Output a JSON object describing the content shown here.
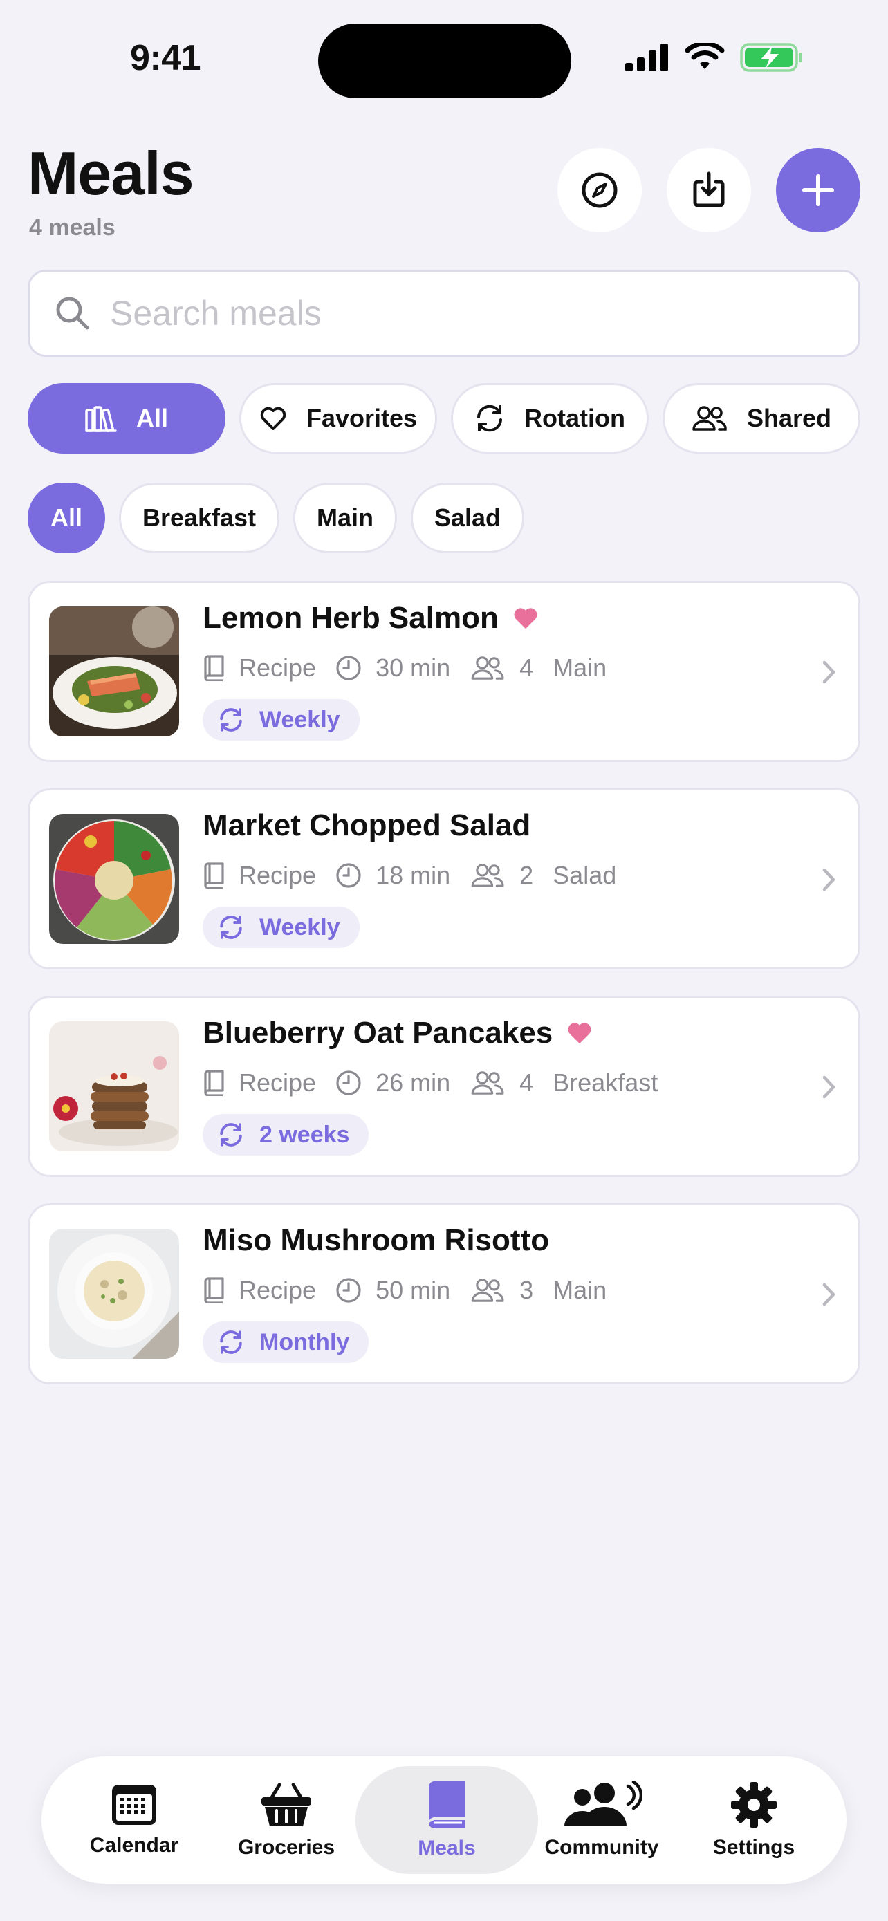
{
  "status_bar": {
    "time": "9:41"
  },
  "header": {
    "title": "Meals",
    "subtitle": "4 meals"
  },
  "search": {
    "placeholder": "Search meals",
    "value": ""
  },
  "filters": [
    {
      "label": "All",
      "icon": "library-icon",
      "active": true
    },
    {
      "label": "Favorites",
      "icon": "heart-outline-icon",
      "active": false
    },
    {
      "label": "Rotation",
      "icon": "rotation-icon",
      "active": false
    },
    {
      "label": "Shared",
      "icon": "people-icon",
      "active": false
    }
  ],
  "categories": [
    {
      "label": "All",
      "active": true
    },
    {
      "label": "Breakfast",
      "active": false
    },
    {
      "label": "Main",
      "active": false
    },
    {
      "label": "Salad",
      "active": false
    }
  ],
  "meals": [
    {
      "title": "Lemon Herb Salmon",
      "favorite": true,
      "source": "Recipe",
      "time": "30 min",
      "servings": "4",
      "category": "Main",
      "rotation": "Weekly"
    },
    {
      "title": "Market Chopped Salad",
      "favorite": false,
      "source": "Recipe",
      "time": "18 min",
      "servings": "2",
      "category": "Salad",
      "rotation": "Weekly"
    },
    {
      "title": "Blueberry Oat Pancakes",
      "favorite": true,
      "source": "Recipe",
      "time": "26 min",
      "servings": "4",
      "category": "Breakfast",
      "rotation": "2 weeks"
    },
    {
      "title": "Miso Mushroom Risotto",
      "favorite": false,
      "source": "Recipe",
      "time": "50 min",
      "servings": "3",
      "category": "Main",
      "rotation": "Monthly"
    }
  ],
  "tabs": [
    {
      "label": "Calendar",
      "icon": "calendar-icon",
      "active": false
    },
    {
      "label": "Groceries",
      "icon": "basket-icon",
      "active": false
    },
    {
      "label": "Meals",
      "icon": "book-icon",
      "active": true
    },
    {
      "label": "Community",
      "icon": "community-icon",
      "active": false
    },
    {
      "label": "Settings",
      "icon": "gear-icon",
      "active": false
    }
  ],
  "colors": {
    "accent": "#7a6bde",
    "favorite": "#e8709a",
    "background": "#f3f2f9",
    "battery": "#34c759"
  }
}
